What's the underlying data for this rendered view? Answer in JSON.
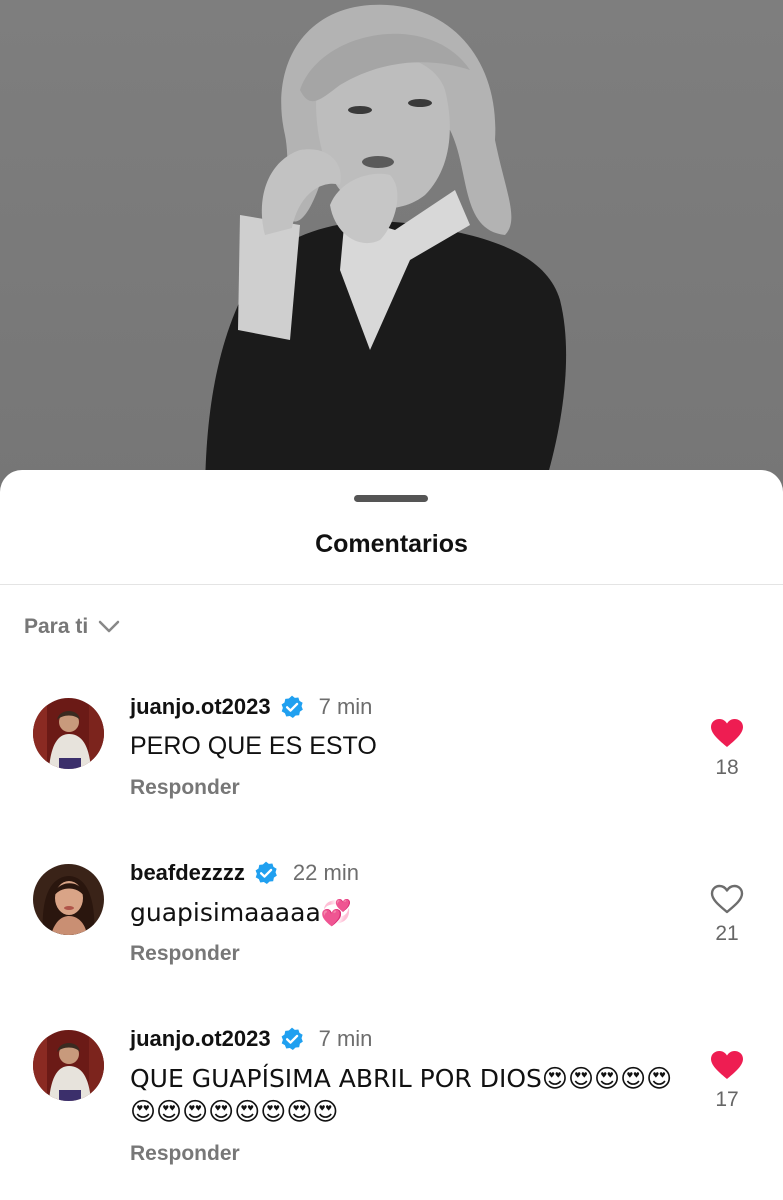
{
  "sheet": {
    "title": "Comentarios",
    "sort_label": "Para ti"
  },
  "colors": {
    "like_active": "#ee1d52",
    "verified": "#20a0f0"
  },
  "comments": [
    {
      "username": "juanjo.ot2023",
      "verified": true,
      "time": "7 min",
      "text": "PERO QUE ES ESTO",
      "reply_label": "Responder",
      "likes": "18",
      "liked": true
    },
    {
      "username": "beafdezzzz",
      "verified": true,
      "time": "22 min",
      "text": "guapisimaaaaa💞",
      "reply_label": "Responder",
      "likes": "21",
      "liked": false
    },
    {
      "username": "juanjo.ot2023",
      "verified": true,
      "time": "7 min",
      "text": "QUE GUAPÍSIMA ABRIL POR DIOS😍😍😍😍😍😍😍😍😍😍😍😍😍",
      "reply_label": "Responder",
      "likes": "17",
      "liked": true
    }
  ]
}
